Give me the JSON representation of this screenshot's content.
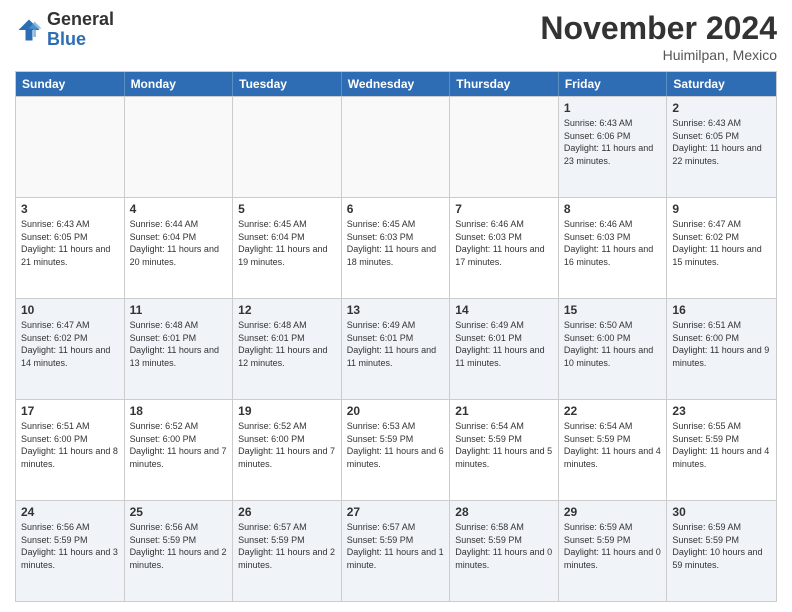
{
  "logo": {
    "line1": "General",
    "line2": "Blue"
  },
  "title": "November 2024",
  "subtitle": "Huimilpan, Mexico",
  "header": {
    "days": [
      "Sunday",
      "Monday",
      "Tuesday",
      "Wednesday",
      "Thursday",
      "Friday",
      "Saturday"
    ]
  },
  "weeks": [
    {
      "cells": [
        {
          "day": "",
          "sunrise": "",
          "sunset": "",
          "daylight": "",
          "empty": true
        },
        {
          "day": "",
          "sunrise": "",
          "sunset": "",
          "daylight": "",
          "empty": true
        },
        {
          "day": "",
          "sunrise": "",
          "sunset": "",
          "daylight": "",
          "empty": true
        },
        {
          "day": "",
          "sunrise": "",
          "sunset": "",
          "daylight": "",
          "empty": true
        },
        {
          "day": "",
          "sunrise": "",
          "sunset": "",
          "daylight": "",
          "empty": true
        },
        {
          "day": "1",
          "sunrise": "Sunrise: 6:43 AM",
          "sunset": "Sunset: 6:06 PM",
          "daylight": "Daylight: 11 hours and 23 minutes.",
          "empty": false
        },
        {
          "day": "2",
          "sunrise": "Sunrise: 6:43 AM",
          "sunset": "Sunset: 6:05 PM",
          "daylight": "Daylight: 11 hours and 22 minutes.",
          "empty": false
        }
      ]
    },
    {
      "cells": [
        {
          "day": "3",
          "sunrise": "Sunrise: 6:43 AM",
          "sunset": "Sunset: 6:05 PM",
          "daylight": "Daylight: 11 hours and 21 minutes.",
          "empty": false
        },
        {
          "day": "4",
          "sunrise": "Sunrise: 6:44 AM",
          "sunset": "Sunset: 6:04 PM",
          "daylight": "Daylight: 11 hours and 20 minutes.",
          "empty": false
        },
        {
          "day": "5",
          "sunrise": "Sunrise: 6:45 AM",
          "sunset": "Sunset: 6:04 PM",
          "daylight": "Daylight: 11 hours and 19 minutes.",
          "empty": false
        },
        {
          "day": "6",
          "sunrise": "Sunrise: 6:45 AM",
          "sunset": "Sunset: 6:03 PM",
          "daylight": "Daylight: 11 hours and 18 minutes.",
          "empty": false
        },
        {
          "day": "7",
          "sunrise": "Sunrise: 6:46 AM",
          "sunset": "Sunset: 6:03 PM",
          "daylight": "Daylight: 11 hours and 17 minutes.",
          "empty": false
        },
        {
          "day": "8",
          "sunrise": "Sunrise: 6:46 AM",
          "sunset": "Sunset: 6:03 PM",
          "daylight": "Daylight: 11 hours and 16 minutes.",
          "empty": false
        },
        {
          "day": "9",
          "sunrise": "Sunrise: 6:47 AM",
          "sunset": "Sunset: 6:02 PM",
          "daylight": "Daylight: 11 hours and 15 minutes.",
          "empty": false
        }
      ]
    },
    {
      "cells": [
        {
          "day": "10",
          "sunrise": "Sunrise: 6:47 AM",
          "sunset": "Sunset: 6:02 PM",
          "daylight": "Daylight: 11 hours and 14 minutes.",
          "empty": false
        },
        {
          "day": "11",
          "sunrise": "Sunrise: 6:48 AM",
          "sunset": "Sunset: 6:01 PM",
          "daylight": "Daylight: 11 hours and 13 minutes.",
          "empty": false
        },
        {
          "day": "12",
          "sunrise": "Sunrise: 6:48 AM",
          "sunset": "Sunset: 6:01 PM",
          "daylight": "Daylight: 11 hours and 12 minutes.",
          "empty": false
        },
        {
          "day": "13",
          "sunrise": "Sunrise: 6:49 AM",
          "sunset": "Sunset: 6:01 PM",
          "daylight": "Daylight: 11 hours and 11 minutes.",
          "empty": false
        },
        {
          "day": "14",
          "sunrise": "Sunrise: 6:49 AM",
          "sunset": "Sunset: 6:01 PM",
          "daylight": "Daylight: 11 hours and 11 minutes.",
          "empty": false
        },
        {
          "day": "15",
          "sunrise": "Sunrise: 6:50 AM",
          "sunset": "Sunset: 6:00 PM",
          "daylight": "Daylight: 11 hours and 10 minutes.",
          "empty": false
        },
        {
          "day": "16",
          "sunrise": "Sunrise: 6:51 AM",
          "sunset": "Sunset: 6:00 PM",
          "daylight": "Daylight: 11 hours and 9 minutes.",
          "empty": false
        }
      ]
    },
    {
      "cells": [
        {
          "day": "17",
          "sunrise": "Sunrise: 6:51 AM",
          "sunset": "Sunset: 6:00 PM",
          "daylight": "Daylight: 11 hours and 8 minutes.",
          "empty": false
        },
        {
          "day": "18",
          "sunrise": "Sunrise: 6:52 AM",
          "sunset": "Sunset: 6:00 PM",
          "daylight": "Daylight: 11 hours and 7 minutes.",
          "empty": false
        },
        {
          "day": "19",
          "sunrise": "Sunrise: 6:52 AM",
          "sunset": "Sunset: 6:00 PM",
          "daylight": "Daylight: 11 hours and 7 minutes.",
          "empty": false
        },
        {
          "day": "20",
          "sunrise": "Sunrise: 6:53 AM",
          "sunset": "Sunset: 5:59 PM",
          "daylight": "Daylight: 11 hours and 6 minutes.",
          "empty": false
        },
        {
          "day": "21",
          "sunrise": "Sunrise: 6:54 AM",
          "sunset": "Sunset: 5:59 PM",
          "daylight": "Daylight: 11 hours and 5 minutes.",
          "empty": false
        },
        {
          "day": "22",
          "sunrise": "Sunrise: 6:54 AM",
          "sunset": "Sunset: 5:59 PM",
          "daylight": "Daylight: 11 hours and 4 minutes.",
          "empty": false
        },
        {
          "day": "23",
          "sunrise": "Sunrise: 6:55 AM",
          "sunset": "Sunset: 5:59 PM",
          "daylight": "Daylight: 11 hours and 4 minutes.",
          "empty": false
        }
      ]
    },
    {
      "cells": [
        {
          "day": "24",
          "sunrise": "Sunrise: 6:56 AM",
          "sunset": "Sunset: 5:59 PM",
          "daylight": "Daylight: 11 hours and 3 minutes.",
          "empty": false
        },
        {
          "day": "25",
          "sunrise": "Sunrise: 6:56 AM",
          "sunset": "Sunset: 5:59 PM",
          "daylight": "Daylight: 11 hours and 2 minutes.",
          "empty": false
        },
        {
          "day": "26",
          "sunrise": "Sunrise: 6:57 AM",
          "sunset": "Sunset: 5:59 PM",
          "daylight": "Daylight: 11 hours and 2 minutes.",
          "empty": false
        },
        {
          "day": "27",
          "sunrise": "Sunrise: 6:57 AM",
          "sunset": "Sunset: 5:59 PM",
          "daylight": "Daylight: 11 hours and 1 minute.",
          "empty": false
        },
        {
          "day": "28",
          "sunrise": "Sunrise: 6:58 AM",
          "sunset": "Sunset: 5:59 PM",
          "daylight": "Daylight: 11 hours and 0 minutes.",
          "empty": false
        },
        {
          "day": "29",
          "sunrise": "Sunrise: 6:59 AM",
          "sunset": "Sunset: 5:59 PM",
          "daylight": "Daylight: 11 hours and 0 minutes.",
          "empty": false
        },
        {
          "day": "30",
          "sunrise": "Sunrise: 6:59 AM",
          "sunset": "Sunset: 5:59 PM",
          "daylight": "Daylight: 10 hours and 59 minutes.",
          "empty": false
        }
      ]
    }
  ]
}
